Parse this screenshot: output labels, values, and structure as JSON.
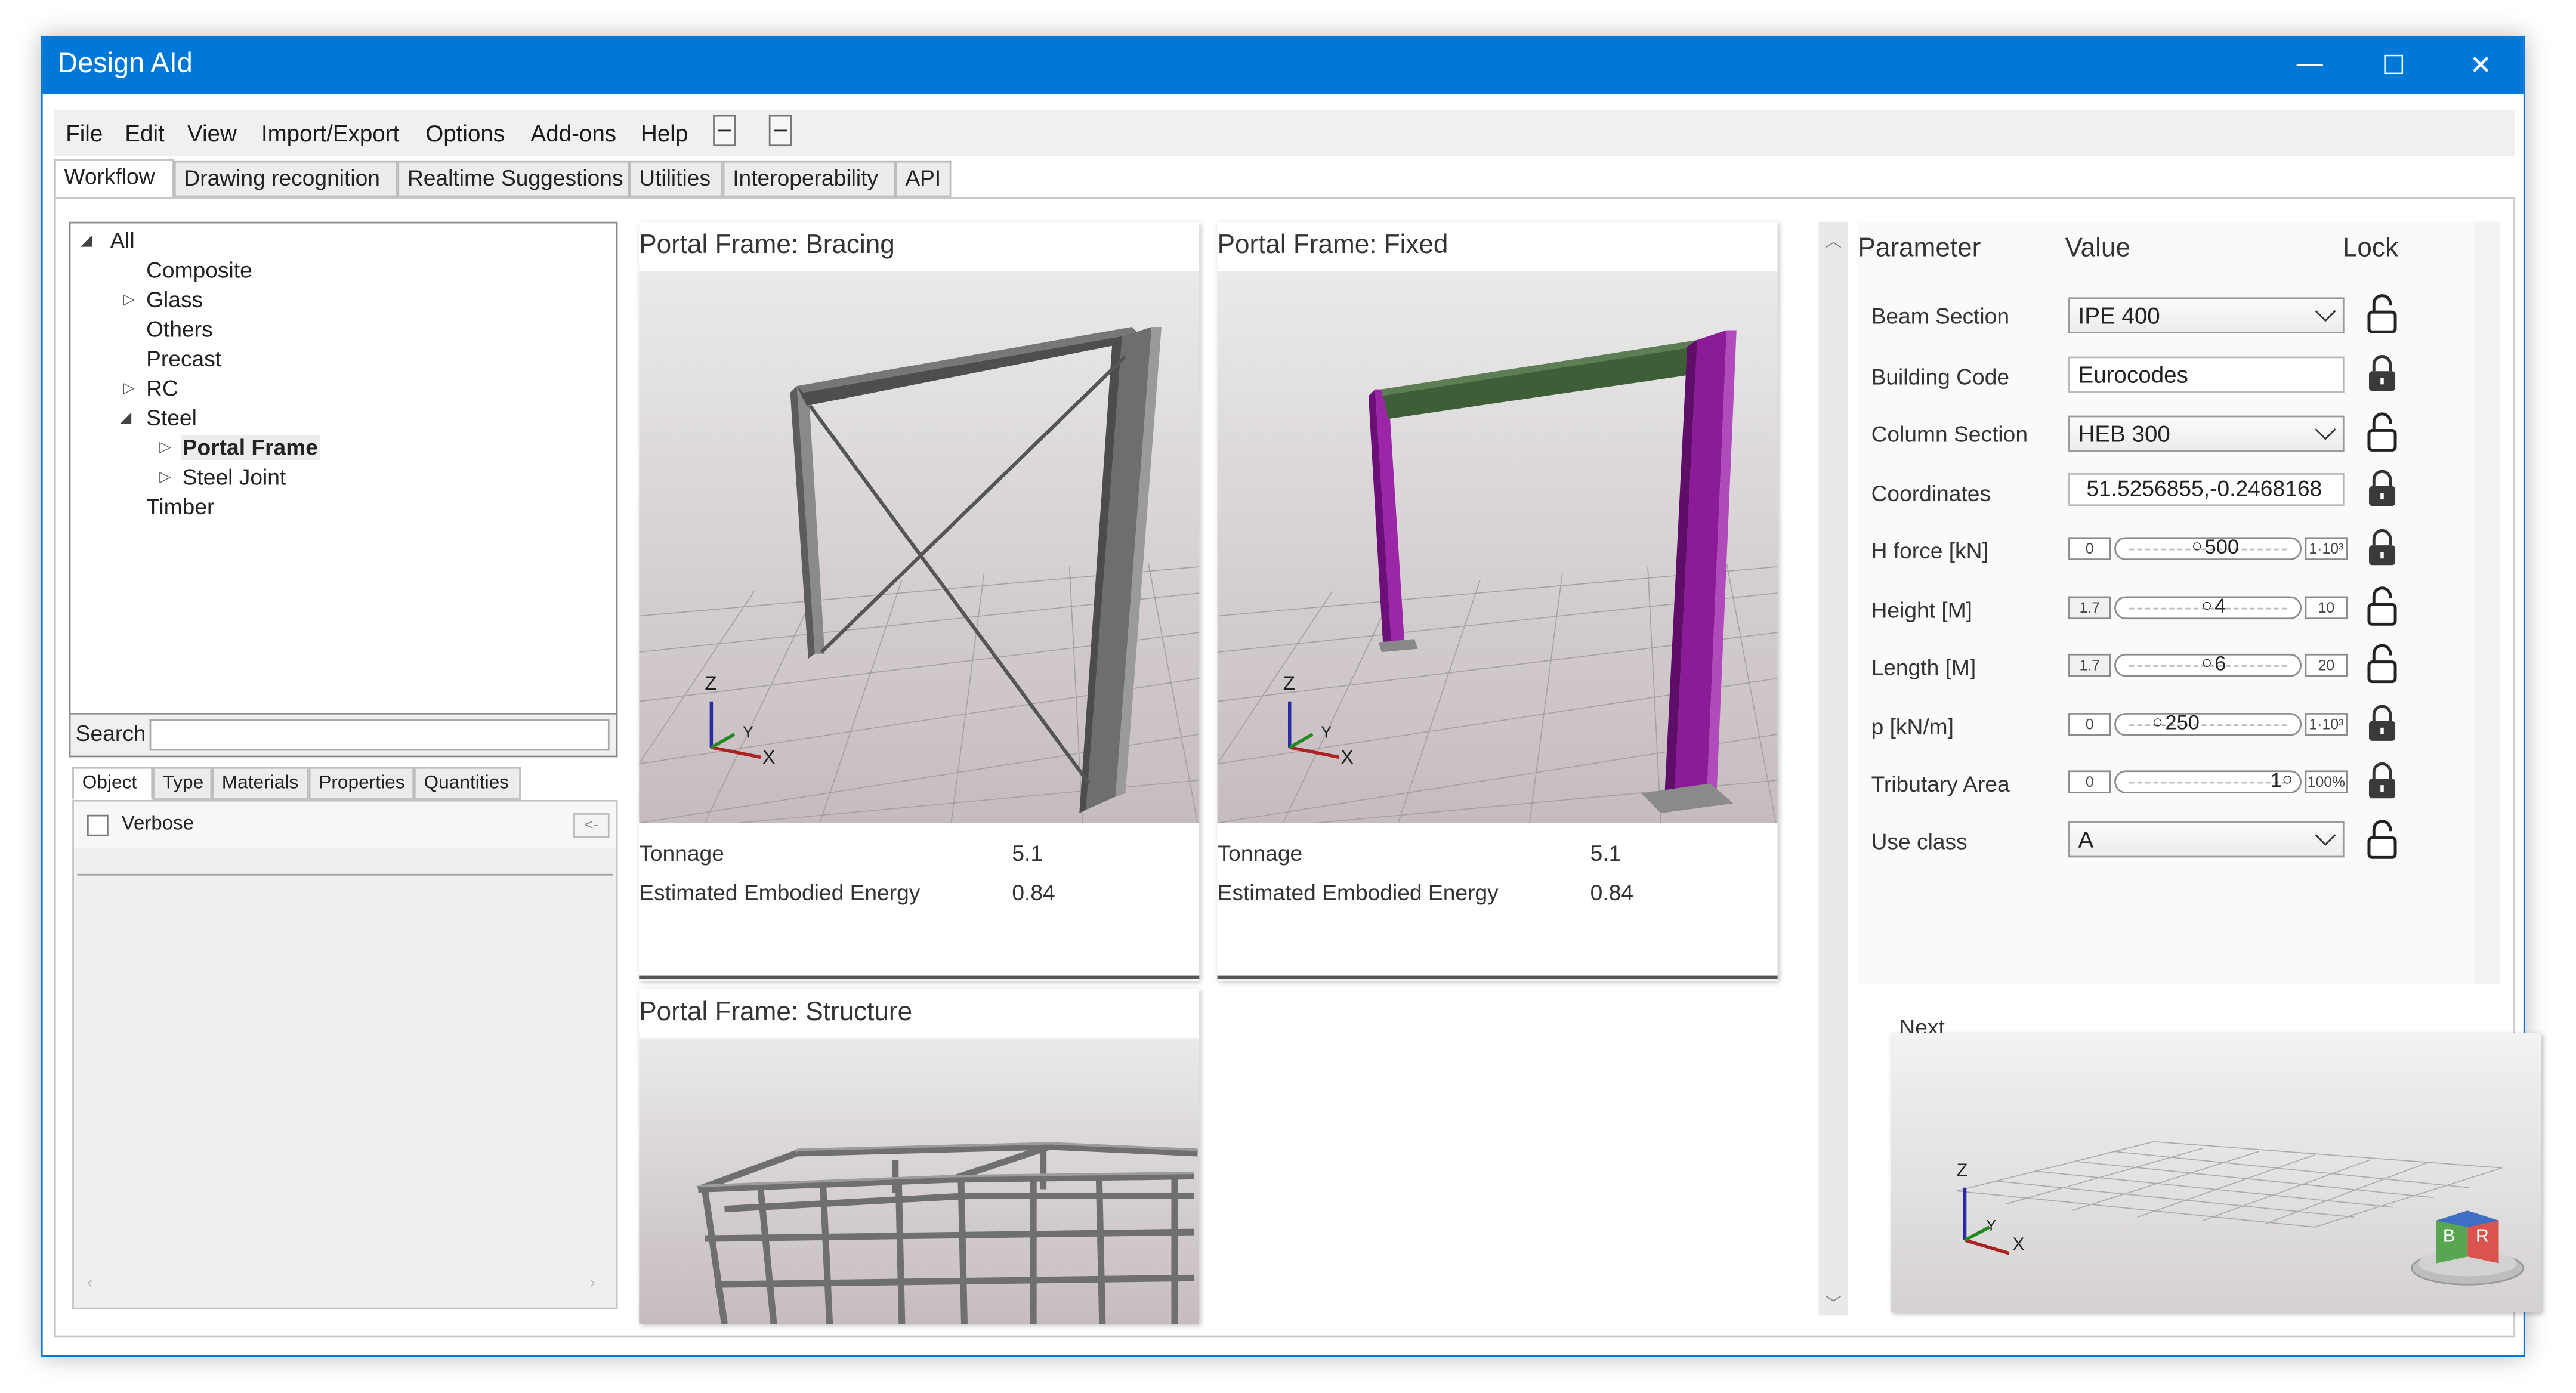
{
  "window": {
    "title": "Design AId",
    "controls": {
      "minimize": "—",
      "maximize": "☐",
      "close": "✕"
    }
  },
  "menu": [
    "File",
    "Edit",
    "View",
    "Import/Export",
    "Options",
    "Add-ons",
    "Help"
  ],
  "tabs": [
    "Workflow",
    "Drawing recognition",
    "Realtime Suggestions",
    "Utilities",
    "Interoperability",
    "API"
  ],
  "tree": [
    "All",
    "Composite",
    "Glass",
    "Others",
    "Precast",
    "RC",
    "Steel",
    "Portal Frame",
    "Steel Joint",
    "Timber"
  ],
  "search": {
    "label": "Search",
    "value": ""
  },
  "object_tabs": [
    "Object",
    "Type",
    "Materials",
    "Properties",
    "Quantities"
  ],
  "object_panel": {
    "verbose_label": "Verbose",
    "back_button": "<-"
  },
  "cards": [
    {
      "title": "Portal Frame: Bracing",
      "rows": [
        {
          "label": "Tonnage",
          "value": "5.1"
        },
        {
          "label": "Estimated Embodied Energy",
          "value": "0.84"
        }
      ]
    },
    {
      "title": "Portal Frame: Fixed",
      "rows": [
        {
          "label": "Tonnage",
          "value": "5.1"
        },
        {
          "label": "Estimated Embodied Energy",
          "value": "0.84"
        }
      ]
    },
    {
      "title": "Portal Frame: Structure"
    }
  ],
  "axes": {
    "z": "Z",
    "y": "Y",
    "x": "X"
  },
  "params": {
    "headers": {
      "parameter": "Parameter",
      "value": "Value",
      "lock": "Lock"
    },
    "beam_section": {
      "label": "Beam Section",
      "value": "IPE 400"
    },
    "building_code": {
      "label": "Building Code",
      "value": "Eurocodes"
    },
    "column_section": {
      "label": "Column Section",
      "value": "HEB 300"
    },
    "coordinates": {
      "label": "Coordinates",
      "value": "51.5256855,-0.2468168"
    },
    "h_force": {
      "label": "H force [kN]",
      "min": "0",
      "value": "500",
      "max": "1·10³"
    },
    "height": {
      "label": "Height [M]",
      "min": "1.7",
      "value": "4",
      "max": "10"
    },
    "length": {
      "label": "Length [M]",
      "min": "1.7",
      "value": "6",
      "max": "20"
    },
    "p": {
      "label": "p [kN/m]",
      "min": "0",
      "value": "250",
      "max": "1·10³"
    },
    "tributary": {
      "label": "Tributary Area",
      "min": "0",
      "value": "1",
      "max": "100%"
    },
    "use_class": {
      "label": "Use class",
      "value": "A"
    }
  },
  "next": {
    "label": "Next",
    "cube": {
      "left": "B",
      "right": "R"
    }
  },
  "colors": {
    "accent": "#0078d7",
    "fixed_beam": "#3d5e36",
    "fixed_column": "#8b1b96",
    "steel": "#6b6b6b"
  }
}
